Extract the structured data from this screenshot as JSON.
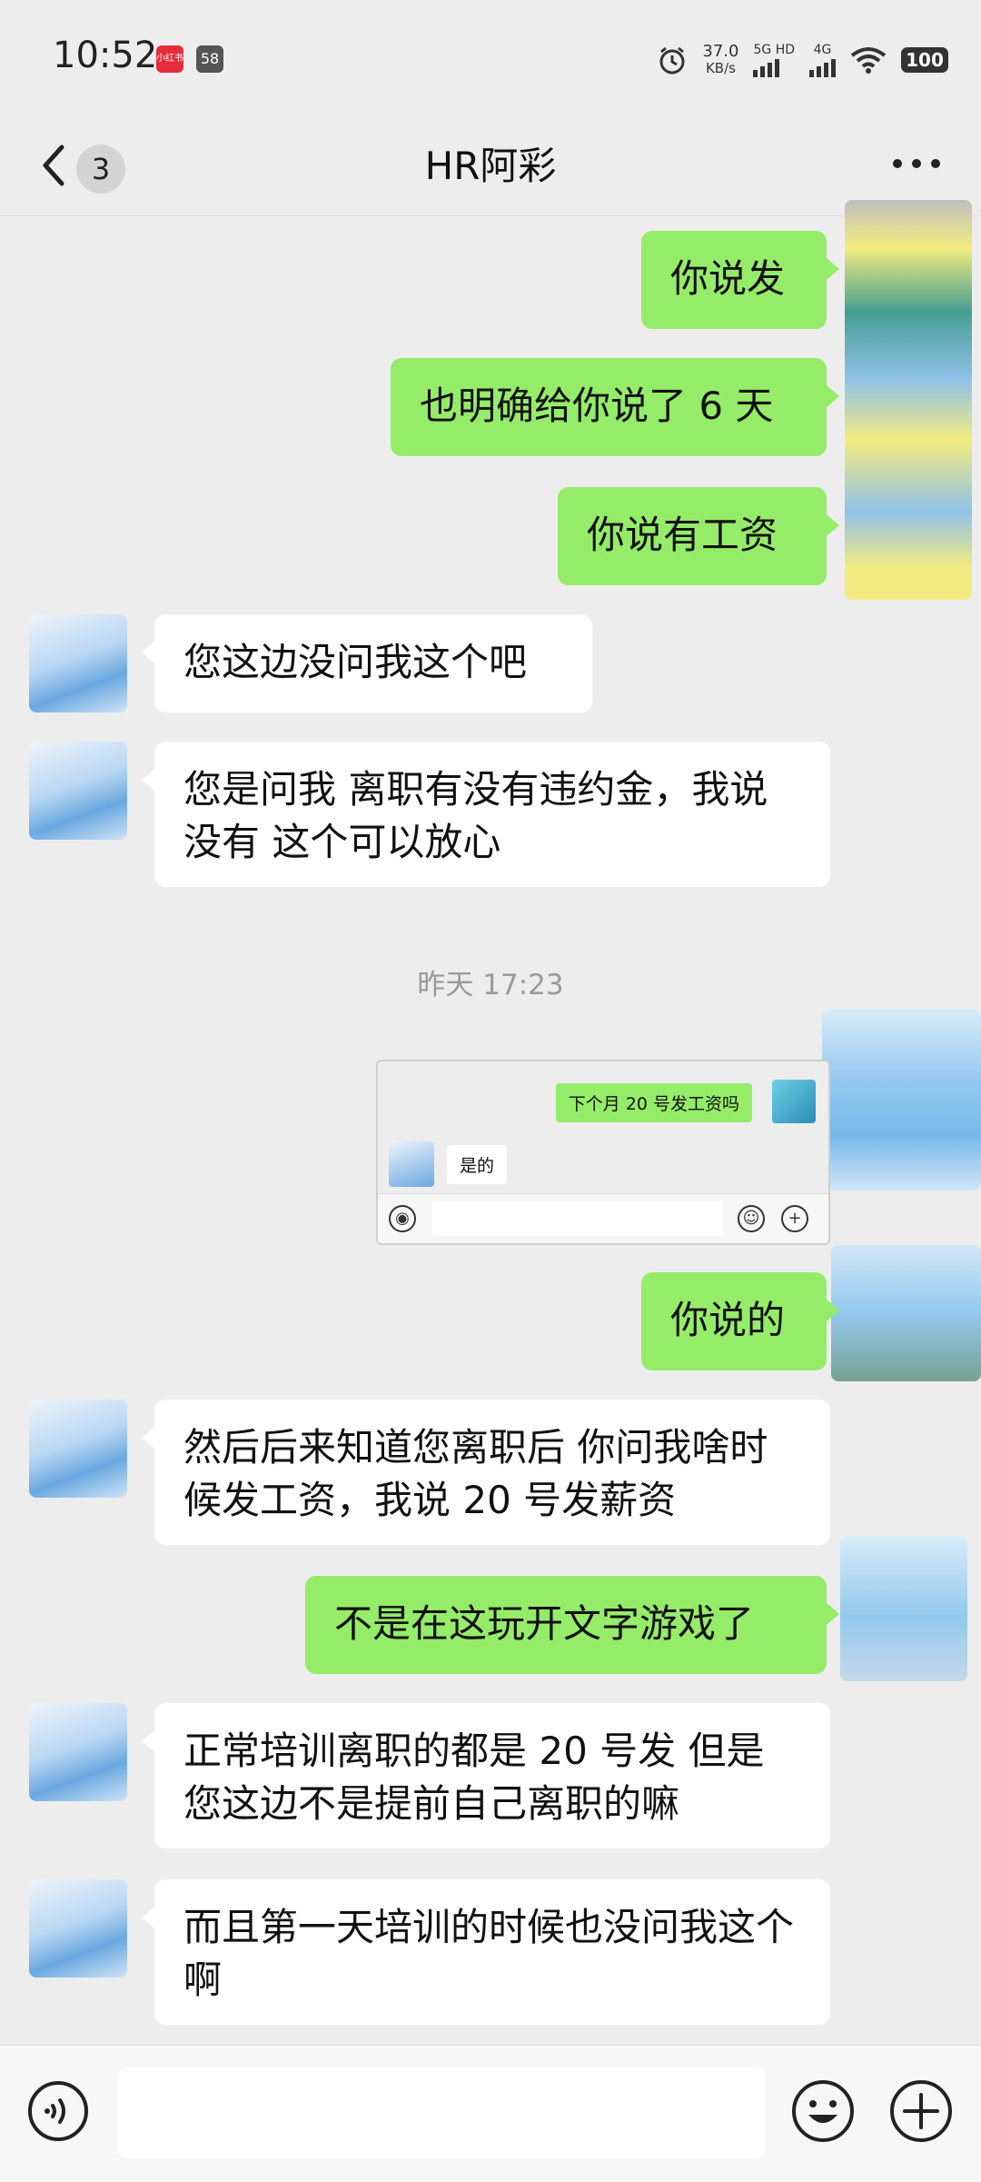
{
  "status_bar": {
    "time": "10:52",
    "badge_red": "小红书",
    "badge_gray": "58",
    "speed_value": "37.0",
    "speed_unit": "KB/s",
    "net1": "5G HD",
    "net2": "4G",
    "battery": "100"
  },
  "header": {
    "unread_count": "3",
    "title": "HR阿彩"
  },
  "messages": [
    {
      "dir": "out",
      "text": "你说发"
    },
    {
      "dir": "out",
      "text": "也明确给你说了 6 天"
    },
    {
      "dir": "out",
      "text": "你说有工资"
    },
    {
      "dir": "in",
      "text": "您这边没问我这个吧"
    },
    {
      "dir": "in",
      "text": "您是问我 离职有没有违约金，我说没有 这个可以放心"
    },
    {
      "dir": "out",
      "text": "你说的"
    },
    {
      "dir": "in",
      "text": "然后后来知道您离职后  你问我啥时候发工资，我说 20 号发薪资"
    },
    {
      "dir": "out",
      "text": "不是在这玩开文字游戏了"
    },
    {
      "dir": "in",
      "text": "正常培训离职的都是 20 号发 但是您这边不是提前自己离职的嘛"
    },
    {
      "dir": "in",
      "text": "而且第一天培训的时候也没问我这个啊"
    }
  ],
  "timestamp": "昨天 17:23",
  "screenshot": {
    "out_text": "下个月 20 号发工资吗",
    "in_text": "是的"
  },
  "colors": {
    "background": "#ededed",
    "bubble_out": "#95ec69",
    "bubble_in": "#ffffff"
  }
}
